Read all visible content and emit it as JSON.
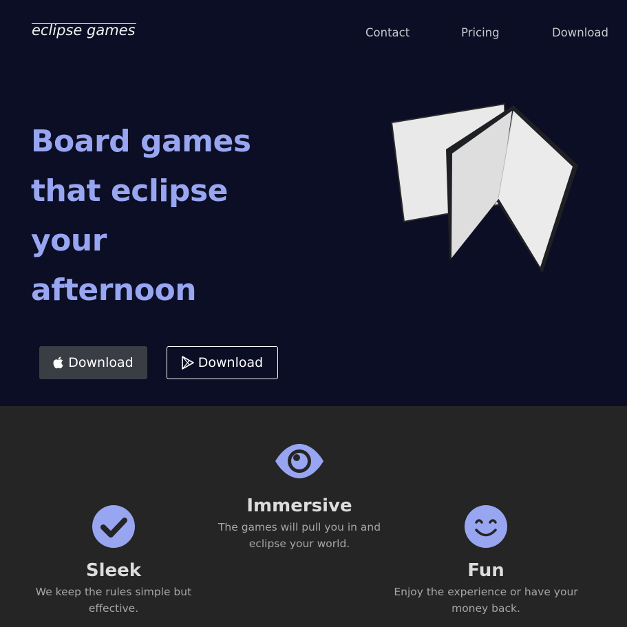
{
  "header": {
    "brand": "eclipse games",
    "nav": [
      {
        "label": "Contact"
      },
      {
        "label": "Pricing"
      },
      {
        "label": "Download"
      }
    ]
  },
  "hero": {
    "title_lines": [
      "Board games",
      "that eclipse",
      "your",
      "afternoon"
    ],
    "buttons": [
      {
        "label": "Download",
        "icon": "apple-icon"
      },
      {
        "label": "Download",
        "icon": "google-play-icon"
      }
    ]
  },
  "features": [
    {
      "title": "Sleek",
      "description": "We keep the rules simple but effective.",
      "icon": "check-circle-icon"
    },
    {
      "title": "Immersive",
      "description": "The games will pull you in and eclipse your world.",
      "icon": "eye-icon"
    },
    {
      "title": "Fun",
      "description": "Enjoy the experience or have your money back.",
      "icon": "smile-icon"
    }
  ],
  "colors": {
    "hero_bg": "#0b0e24",
    "accent": "#98a6f2",
    "features_bg": "#252525"
  }
}
